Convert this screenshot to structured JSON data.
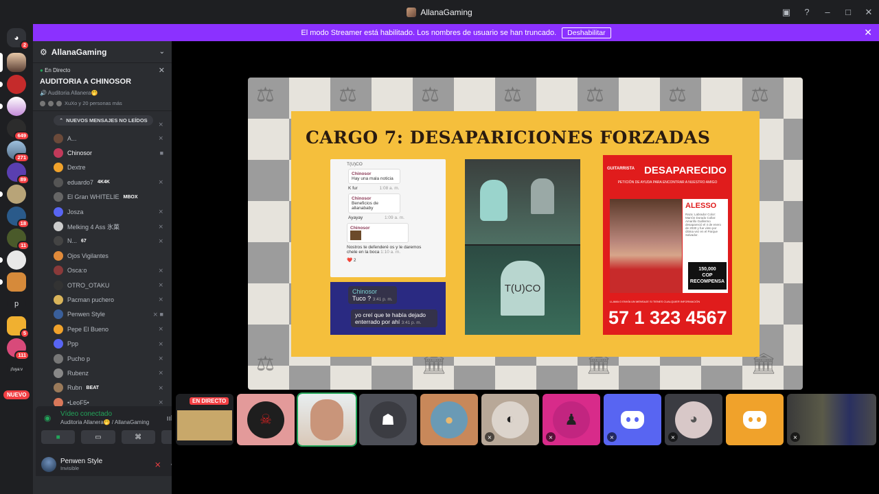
{
  "window": {
    "title": "AllanaGaming"
  },
  "banner": {
    "text": "El modo Streamer está habilitado. Los nombres de usuario se han truncado.",
    "button": "Deshabilitar"
  },
  "guilds": {
    "badges": [
      "2",
      "649",
      "271",
      "89",
      "18",
      "11",
      "5",
      "111"
    ],
    "letter": "p",
    "tagline": "¡fuya:v",
    "new_label": "NUEVO"
  },
  "server": {
    "name": "AllanaGaming"
  },
  "live": {
    "tag": "En Directo",
    "title": "AUDITORIA A CHINOSOR",
    "channel": "Auditoria Allanera🤭",
    "people": "XuXo y 20 personas más"
  },
  "unread_pill": "NUEVOS MENSAJES NO LEÍDOS",
  "members": [
    {
      "name": "A...",
      "tag": ""
    },
    {
      "name": "Chinosor",
      "tag": ""
    },
    {
      "name": "Dextre",
      "tag": ""
    },
    {
      "name": "eduardo7",
      "tag": "4K4K"
    },
    {
      "name": "El Gran WHITELIE",
      "tag": "MBOX"
    },
    {
      "name": "Josza",
      "tag": ""
    },
    {
      "name": "Melking 4 Ass 氷菓",
      "tag": ""
    },
    {
      "name": "N...",
      "tag": "67"
    },
    {
      "name": "Ojos Vigilantes",
      "tag": ""
    },
    {
      "name": "Osca:o",
      "tag": ""
    },
    {
      "name": "OTRO_OTAKU",
      "tag": ""
    },
    {
      "name": "Pacman puchero",
      "tag": ""
    },
    {
      "name": "Penwen Style",
      "tag": ""
    },
    {
      "name": "Pepe El Bueno",
      "tag": ""
    },
    {
      "name": "Ppp",
      "tag": ""
    },
    {
      "name": "Pucho p",
      "tag": ""
    },
    {
      "name": "Rubenz",
      "tag": ""
    },
    {
      "name": "Rubn",
      "tag": "BEAT"
    },
    {
      "name": "•LeoF5•",
      "tag": ""
    }
  ],
  "voice": {
    "status": "Vídeo conectado",
    "channel": "Auditoria Allanera🤭 / AllanaGaming"
  },
  "user": {
    "name": "Penwen Style",
    "status": "Invisible"
  },
  "slide": {
    "title": "CARGO 7: DESAPARICIONES FORZADAS",
    "chat1": {
      "contact": "T(U)CO",
      "m1_name": "Chinosor",
      "m1_quote": "Hay una mala noticia",
      "m1_text": "K fur",
      "m1_time": "1:08 a. m.",
      "m2_name": "Chinosor",
      "m2_quote": "Beneficios de allanababy",
      "m2_text": "Ayayay",
      "m2_time": "1:09 a. m.",
      "m3_name": "Chinosor",
      "m3_text": "Nostros te defenderé os y le daremos chele en la boca",
      "m3_time": "1:10 a. m.",
      "reaction": "❤️ 2"
    },
    "chat2": {
      "name": "Chinosor",
      "text": "Tuco ?",
      "time": "3:41 p. m.",
      "reply": "yo creí que te había dejado enterrado por ahí",
      "reply_time": "3:41 p. m."
    },
    "meme_text": "T(U)CO",
    "poster": {
      "label": "GUITARRISTA",
      "header": "DESAPARECIDO",
      "subtitle": "PETICIÓN DE AYUDA PARA ENCONTRAR A NUESTRO AMIGO",
      "name": "ALESSO",
      "details": "Raza: Labrador Color: Marrón Dorado Collar: Amarillo Guillermo desapareció el 4 de enero de 2030 y fue visto por última vez en el Parque Salvador.",
      "reward_amount": "150,000",
      "reward_currency": "COP",
      "reward_label": "RECOMPENSA",
      "call": "LLAMA O ENVÍA UN MENSAJE SI TIENES CUALQUIER INFORMACIÓN",
      "phone": "57 1 323 4567"
    }
  },
  "tiles": {
    "live_badge": "EN DIRECTO"
  }
}
